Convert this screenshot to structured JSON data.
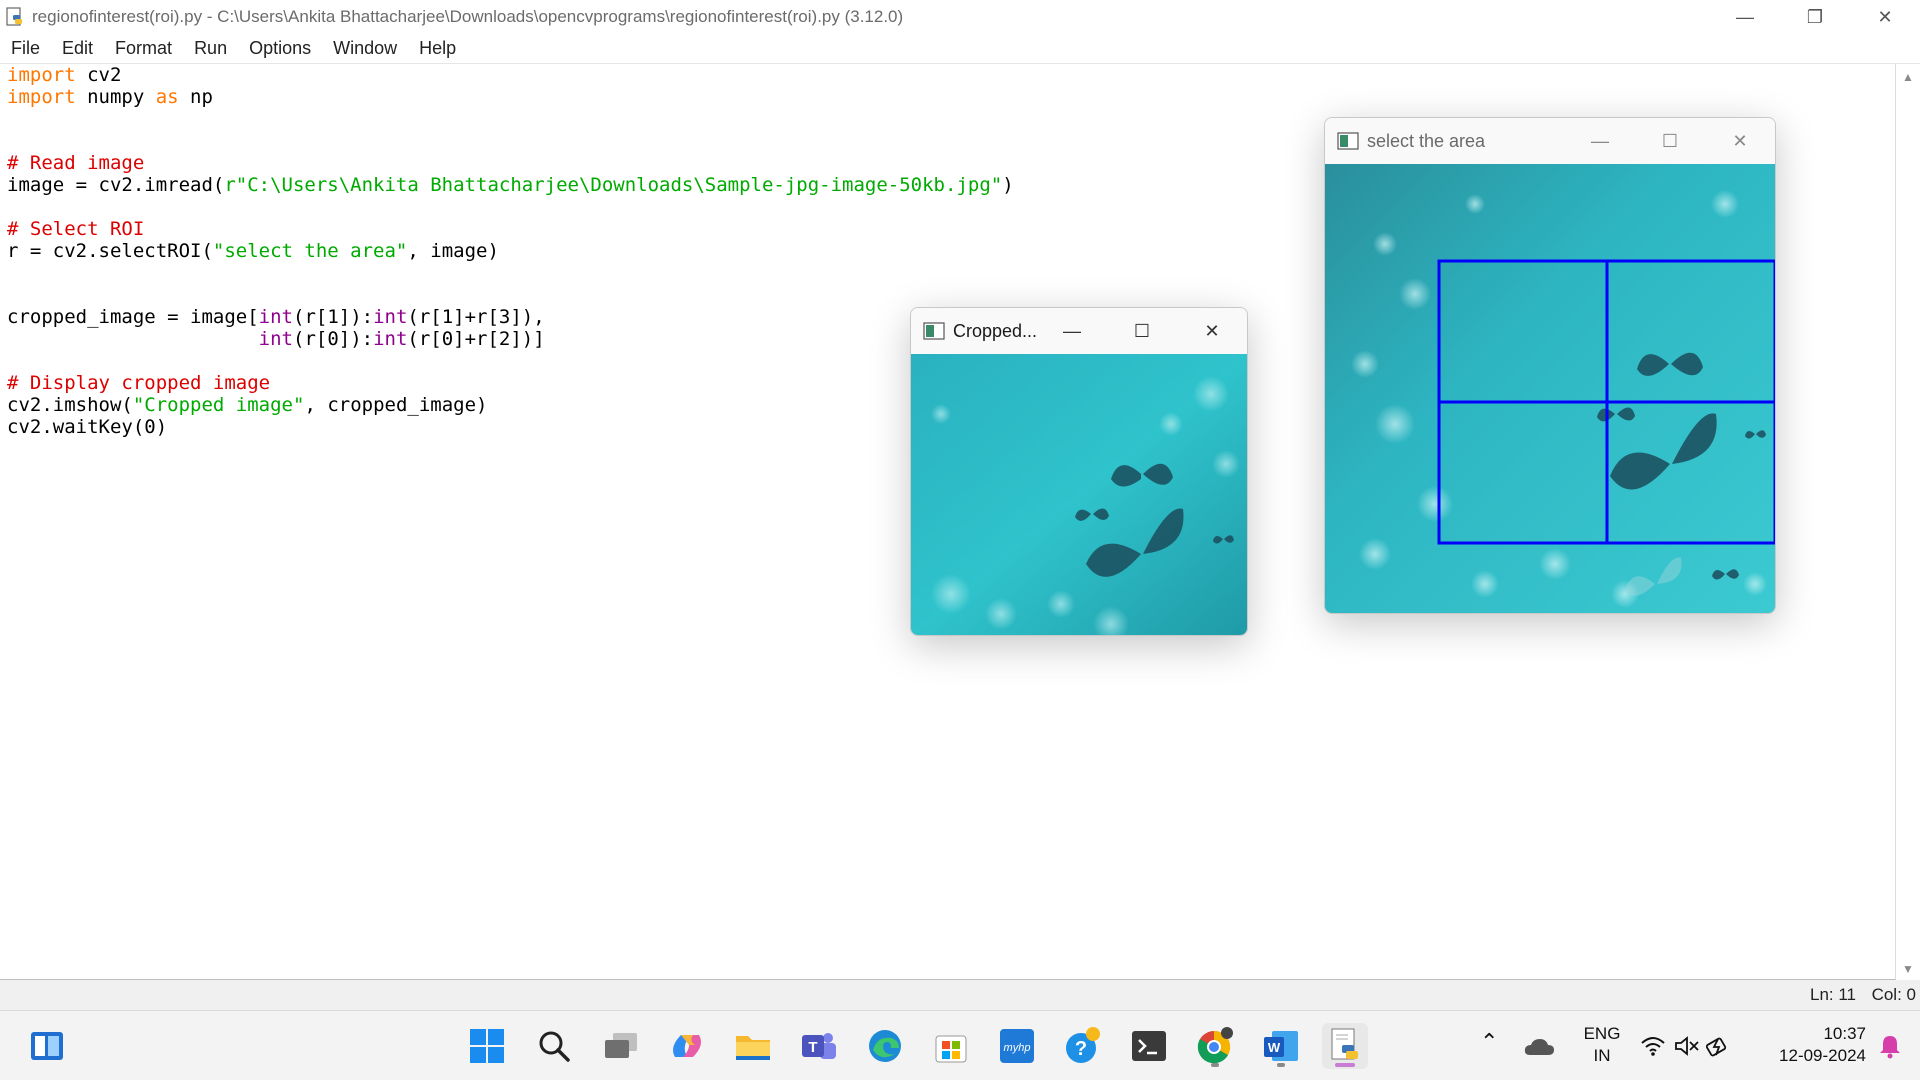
{
  "window": {
    "title": "regionofinterest(roi).py - C:\\Users\\Ankita Bhattacharjee\\Downloads\\opencvprograms\\regionofinterest(roi).py (3.12.0)"
  },
  "menu": [
    "File",
    "Edit",
    "Format",
    "Run",
    "Options",
    "Window",
    "Help"
  ],
  "code": {
    "lines": [
      [
        {
          "t": "kw",
          "v": "import"
        },
        {
          "t": "",
          "v": " cv2"
        }
      ],
      [
        {
          "t": "kw",
          "v": "import"
        },
        {
          "t": "",
          "v": " numpy "
        },
        {
          "t": "kw",
          "v": "as"
        },
        {
          "t": "",
          "v": " np"
        }
      ],
      [],
      [],
      [
        {
          "t": "cm",
          "v": "# Read image"
        }
      ],
      [
        {
          "t": "",
          "v": "image = cv2.imread("
        },
        {
          "t": "st",
          "v": "r\"C:\\Users\\Ankita Bhattacharjee\\Downloads\\Sample-jpg-image-50kb.jpg\""
        },
        {
          "t": "",
          "v": ")"
        }
      ],
      [],
      [
        {
          "t": "cm",
          "v": "# Select ROI"
        }
      ],
      [
        {
          "t": "",
          "v": "r = cv2.selectROI("
        },
        {
          "t": "st",
          "v": "\"select the area\""
        },
        {
          "t": "",
          "v": ", image)"
        }
      ],
      [],
      [],
      [
        {
          "t": "",
          "v": "cropped_image = image["
        },
        {
          "t": "bi",
          "v": "int"
        },
        {
          "t": "",
          "v": "(r[1]):"
        },
        {
          "t": "bi",
          "v": "int"
        },
        {
          "t": "",
          "v": "(r[1]+r[3]),"
        }
      ],
      [
        {
          "t": "",
          "v": "                      "
        },
        {
          "t": "bi",
          "v": "int"
        },
        {
          "t": "",
          "v": "(r[0]):"
        },
        {
          "t": "bi",
          "v": "int"
        },
        {
          "t": "",
          "v": "(r[0]+r[2])]"
        }
      ],
      [],
      [
        {
          "t": "cm",
          "v": "# Display cropped image"
        }
      ],
      [
        {
          "t": "",
          "v": "cv2.imshow("
        },
        {
          "t": "st",
          "v": "\"Cropped image\""
        },
        {
          "t": "",
          "v": ", cropped_image)"
        }
      ],
      [
        {
          "t": "",
          "v": "cv2.waitKey(0)"
        }
      ]
    ]
  },
  "status": {
    "ln": "Ln: 11",
    "col": "Col: 0"
  },
  "cropped_window": {
    "title": "Cropped..."
  },
  "select_window": {
    "title": "select the area"
  },
  "taskbar": {
    "apps": [
      "widgets-icon",
      "start-icon",
      "search-icon",
      "task-view-icon",
      "copilot-icon",
      "file-explorer-icon",
      "teams-icon",
      "edge-icon",
      "store-icon",
      "myhp-icon",
      "help-icon",
      "terminal-icon",
      "chrome-icon",
      "word-icon",
      "idle-python-icon"
    ],
    "myhp_label": "myhp",
    "lang_top": "ENG",
    "lang_bottom": "IN",
    "time": "10:37",
    "date": "12-09-2024"
  }
}
